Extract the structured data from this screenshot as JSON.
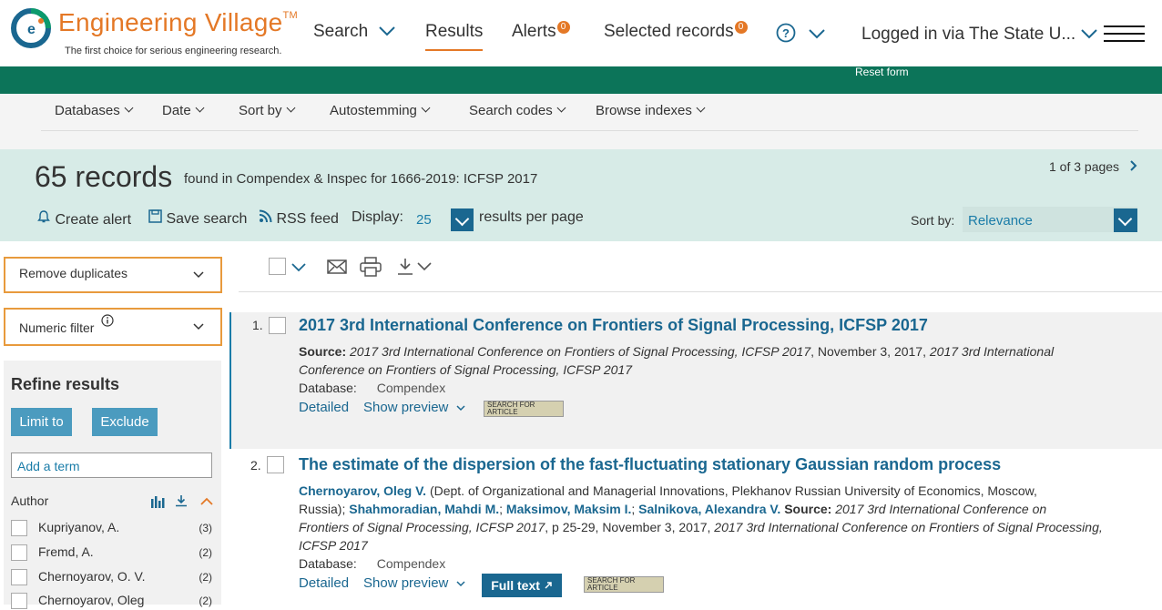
{
  "header": {
    "logo_title": "Engineering Village",
    "logo_tm": "TM",
    "logo_subtitle": "The first choice for serious engineering research.",
    "nav": {
      "search": "Search",
      "results": "Results",
      "alerts": "Alerts",
      "alerts_count": "0",
      "selected": "Selected records",
      "selected_count": "0",
      "logged_in": "Logged in via The State U..."
    }
  },
  "greenbar": {
    "reset": "Reset form"
  },
  "toolbar": {
    "databases": "Databases",
    "date": "Date",
    "sort_by": "Sort by",
    "autostemming": "Autostemming",
    "search_codes": "Search codes",
    "browse_indexes": "Browse indexes"
  },
  "results_bar": {
    "count": "65 records",
    "found": "found in Compendex & Inspec for 1666-2019: ICFSP 2017",
    "pages": "1 of 3 pages",
    "create_alert": "Create alert",
    "save_search": "Save search",
    "rss_feed": "RSS feed",
    "display_label": "Display:",
    "display_value": "25",
    "per_page": "results per page",
    "sort_label": "Sort by:",
    "sort_value": "Relevance"
  },
  "sidebar": {
    "remove_duplicates": "Remove duplicates",
    "numeric_filter": "Numeric filter",
    "refine_title": "Refine results",
    "limit_to": "Limit to",
    "exclude": "Exclude",
    "add_term_placeholder": "Add a term",
    "author_label": "Author",
    "authors": [
      {
        "name": "Kupriyanov, A.",
        "count": "(3)"
      },
      {
        "name": "Fremd, A.",
        "count": "(2)"
      },
      {
        "name": "Chernoyarov, O. V.",
        "count": "(2)"
      },
      {
        "name": "Chernoyarov, Oleg",
        "count": "(2)"
      }
    ]
  },
  "results": [
    {
      "num": "1.",
      "title": "2017 3rd International Conference on Frontiers of Signal Processing, ICFSP 2017",
      "source_label": "Source:",
      "source_line1": "2017 3rd International Conference on Frontiers of Signal Processing, ICFSP 2017",
      "source_mid": ", November 3, 2017, ",
      "source_line1b": "2017 3rd International",
      "source_line2": "Conference on Frontiers of Signal Processing, ICFSP 2017",
      "database_label": "Database:",
      "database": "Compendex",
      "detailed": "Detailed",
      "show_preview": "Show preview",
      "sfa": "SEARCH FOR ARTICLE"
    },
    {
      "num": "2.",
      "title": "The estimate of the dispersion of the fast-fluctuating stationary Gaussian random process",
      "author1": "Chernoyarov, Oleg V.",
      "affil1": " (Dept. of Organizational and Managerial Innovations, Plekhanov Russian University of Economics, Moscow,",
      "affil2": "Russia); ",
      "author2": "Shahmoradian, Mahdi M.",
      "author3": "Maksimov, Maksim I.",
      "author4": "Salnikova, Alexandra V.",
      "source_label": "Source:",
      "source_a": "2017 3rd International Conference on",
      "source_b": "Frontiers of Signal Processing, ICFSP 2017",
      "source_pages": ", p 25-29, November 3, 2017, ",
      "source_c": "2017 3rd International Conference on Frontiers of Signal Processing,",
      "source_d": "ICFSP 2017",
      "database_label": "Database:",
      "database": "Compendex",
      "detailed": "Detailed",
      "show_preview": "Show preview",
      "full_text": "Full text",
      "sfa": "SEARCH FOR ARTICLE"
    }
  ]
}
